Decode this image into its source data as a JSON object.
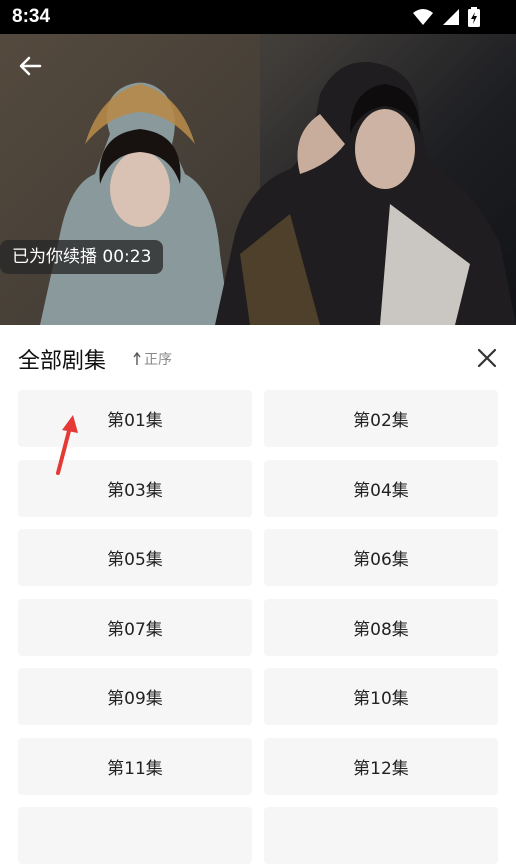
{
  "status_bar": {
    "time": "8:34"
  },
  "player": {
    "resume_text": "已为你续播 00:23"
  },
  "episodes_panel": {
    "title": "全部剧集",
    "sort_label": "正序",
    "episodes": [
      "第01集",
      "第02集",
      "第03集",
      "第04集",
      "第05集",
      "第06集",
      "第07集",
      "第08集",
      "第09集",
      "第10集",
      "第11集",
      "第12集",
      "",
      ""
    ]
  },
  "colors": {
    "annotation_arrow": "#e53935",
    "tile_bg": "#f6f6f6"
  },
  "icons": [
    "back-arrow-icon",
    "wifi-icon",
    "signal-icon",
    "battery-icon",
    "sort-arrow-icon",
    "close-icon"
  ]
}
